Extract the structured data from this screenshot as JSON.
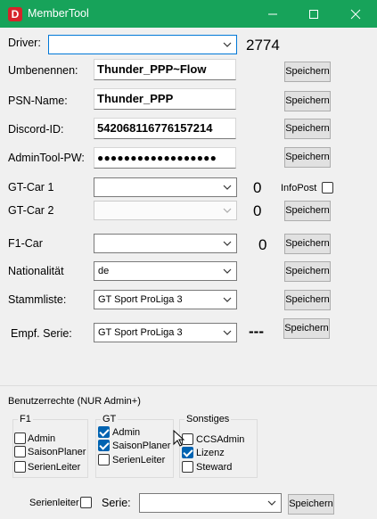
{
  "window": {
    "title": "MemberTool",
    "app_icon_letter": "D",
    "accent": "#17a35a",
    "icons": [
      "minimize-icon",
      "maximize-icon",
      "close-icon"
    ]
  },
  "form": {
    "driver": {
      "label": "Driver:",
      "value": "",
      "number": "2774"
    },
    "rename": {
      "label": "Umbenennen:",
      "value": "Thunder_PPP~Flow",
      "button": "Speichern"
    },
    "psn": {
      "label": "PSN-Name:",
      "value": "Thunder_PPP",
      "button": "Speichern"
    },
    "discord": {
      "label": "Discord-ID:",
      "value": "542068116776157214",
      "button": "Speichern"
    },
    "adminpw": {
      "label": "AdminTool-PW:",
      "value": "●●●●●●●●●●●●●●●●●●",
      "button": "Speichern"
    },
    "gtcar1": {
      "label": "GT-Car 1",
      "value": "",
      "count": "0",
      "infopost": "InfoPost"
    },
    "gtcar2": {
      "label": "GT-Car 2",
      "value": "",
      "count": "0",
      "button": "Speichern"
    },
    "f1car": {
      "label": "F1-Car",
      "value": "",
      "count": "0",
      "button": "Speichern"
    },
    "nationality": {
      "label": "Nationalität",
      "value": "de",
      "button": "Speichern"
    },
    "stammliste": {
      "label": "Stammliste:",
      "value": "GT Sport ProLiga 3",
      "button": "Speichern"
    },
    "series": {
      "label": "Empf. Serie:",
      "value": "GT Sport ProLiga 3",
      "dashes": "---",
      "button": "Speichern"
    }
  },
  "rights": {
    "title": "Benutzerrechte (NUR Admin+)",
    "f1": {
      "title": "F1",
      "admin": "Admin",
      "saisonplaner": "SaisonPlaner",
      "serienleiter": "SerienLeiter",
      "admin_checked": false,
      "saisonplaner_checked": false,
      "serienleiter_checked": false
    },
    "gt": {
      "title": "GT",
      "admin": "Admin",
      "saisonplaner": "SaisonPlaner",
      "serienleiter": "SerienLeiter",
      "admin_checked": true,
      "saisonplaner_checked": true,
      "serienleiter_checked": false
    },
    "sonstiges": {
      "title": "Sonstiges",
      "ccsadmin": "CCSAdmin",
      "lizenz": "Lizenz",
      "steward": "Steward",
      "ccsadmin_checked": false,
      "lizenz_checked": true,
      "steward_checked": false
    }
  },
  "footer": {
    "serienleiter": "Serienleiter",
    "serie_label": "Serie:",
    "serie_value": "",
    "button": "Speichern"
  }
}
